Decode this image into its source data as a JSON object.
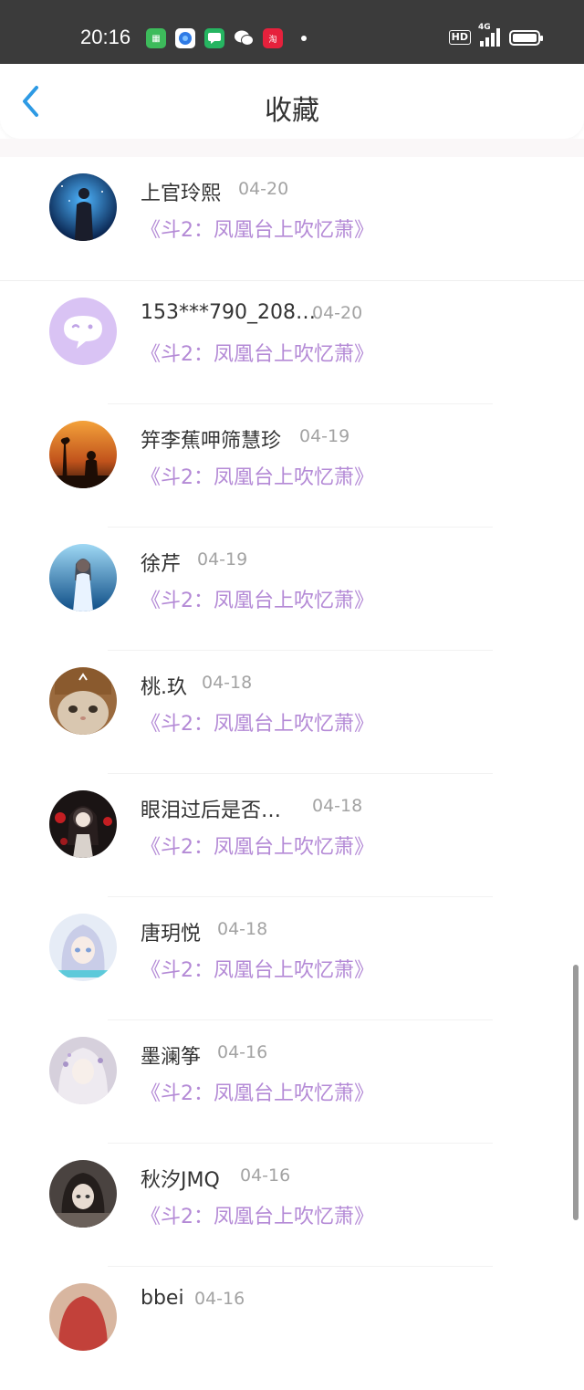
{
  "status_bar": {
    "time": "20:16",
    "hd": "HD",
    "network": "4G",
    "app_icons": [
      "wechat-mini-icon",
      "browser-icon",
      "message-icon",
      "wechat-icon",
      "taobao-icon"
    ]
  },
  "header": {
    "title": "收藏",
    "back_icon": "chevron-left-icon",
    "accent_color": "#2d9ae4"
  },
  "colors": {
    "book_title": "#b48ad6",
    "date": "#a3a3a3",
    "name": "#333333"
  },
  "items": [
    {
      "name": "上官玲熙",
      "date": "04-20",
      "book": "《斗2：凤凰台上吹忆萧》"
    },
    {
      "name": "153***790_208…",
      "date": "04-20",
      "book": "《斗2：凤凰台上吹忆萧》"
    },
    {
      "name": "笄李蕉呷筛慧珍",
      "date": "04-19",
      "book": "《斗2：凤凰台上吹忆萧》"
    },
    {
      "name": "徐芹",
      "date": "04-19",
      "book": "《斗2：凤凰台上吹忆萧》"
    },
    {
      "name": "桃.玖",
      "date": "04-18",
      "book": "《斗2：凤凰台上吹忆萧》"
    },
    {
      "name": "眼泪过后是否…",
      "date": "04-18",
      "book": "《斗2：凤凰台上吹忆萧》"
    },
    {
      "name": "唐玥悦",
      "date": "04-18",
      "book": "《斗2：凤凰台上吹忆萧》"
    },
    {
      "name": "墨澜筝",
      "date": "04-16",
      "book": "《斗2：凤凰台上吹忆萧》"
    },
    {
      "name": "秋汐JMQ",
      "date": "04-16",
      "book": "《斗2：凤凰台上吹忆萧》"
    },
    {
      "name": "bbei",
      "date": "04-16",
      "book": ""
    }
  ]
}
